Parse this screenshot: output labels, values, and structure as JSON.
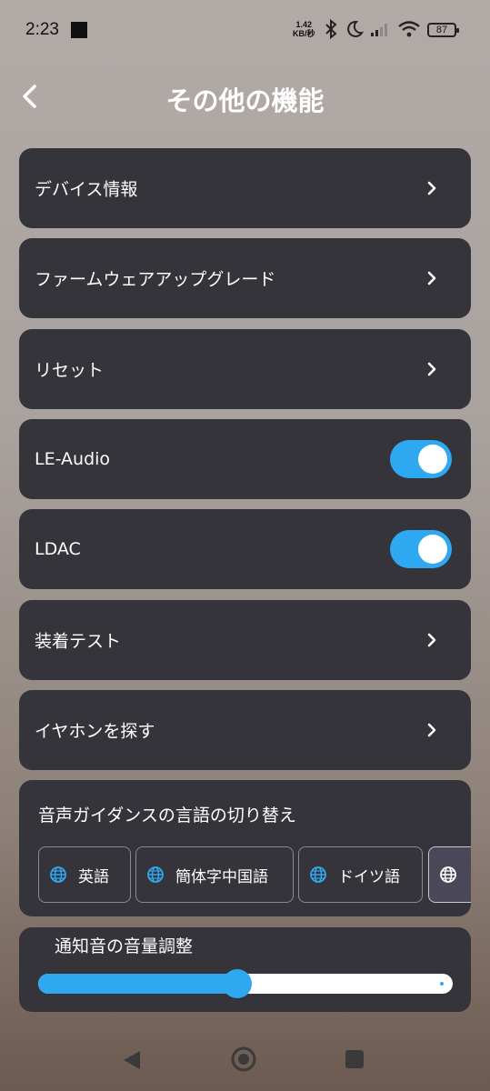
{
  "status_bar": {
    "time": "2:23",
    "net_speed_value": "1.42",
    "net_speed_unit": "KB/秒",
    "battery": "87"
  },
  "header": {
    "title": "その他の機能",
    "back_icon": "back-arrow-icon"
  },
  "menu": {
    "device_info": "デバイス情報",
    "firmware_upgrade": "ファームウェアアップグレード",
    "reset": "リセット",
    "le_audio": "LE-Audio",
    "ldac": "LDAC",
    "fit_test": "装着テスト",
    "find_earphones": "イヤホンを探す"
  },
  "toggles": {
    "le_audio_on": true,
    "ldac_on": true
  },
  "voice_guidance": {
    "title": "音声ガイダンスの言語の切り替え",
    "options": [
      "英語",
      "簡体字中国語",
      "ドイツ語"
    ]
  },
  "notification_volume": {
    "title": "通知音の音量調整",
    "level_fraction": 0.48
  },
  "colors": {
    "accent": "#2ea8f0",
    "card": "#35343a"
  }
}
